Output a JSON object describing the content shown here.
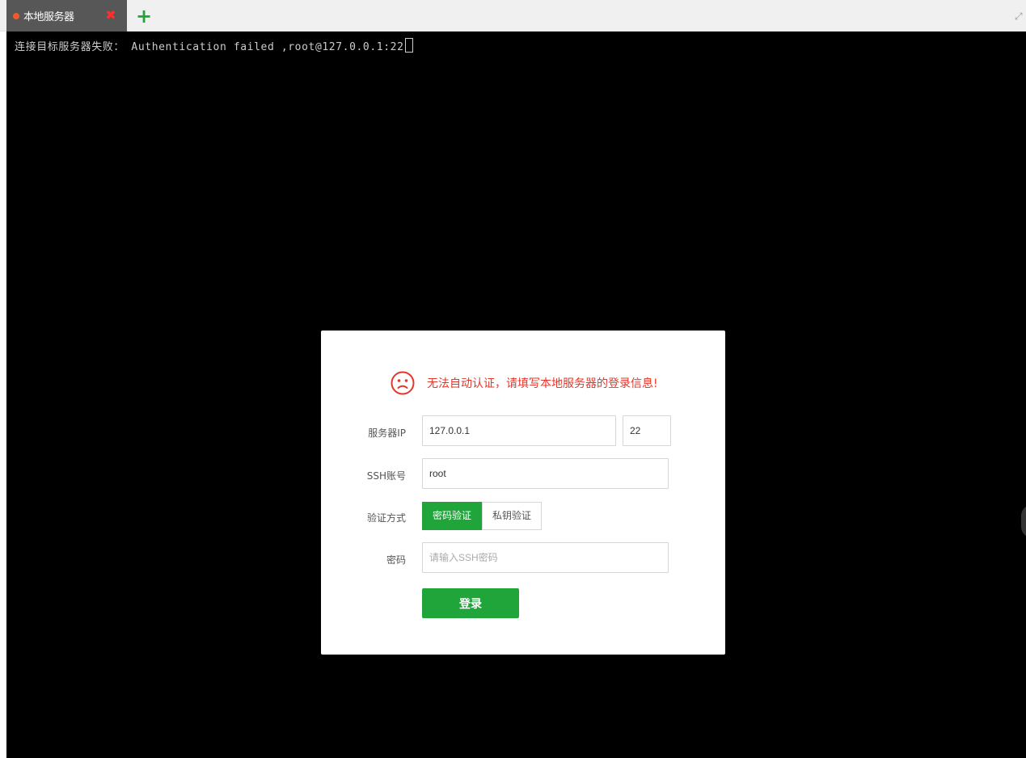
{
  "tabs": [
    {
      "label": "本地服务器",
      "status_color": "#f15a28",
      "close_icon": "close-icon"
    }
  ],
  "add_tab_icon": "plus-icon",
  "terminal": {
    "line": "连接目标服务器失败： Authentication failed ,root@127.0.0.1:22"
  },
  "dialog": {
    "error_icon": "sad-face-icon",
    "error_text": "无法自动认证，请填写本地服务器的登录信息!",
    "server_ip_label": "服务器IP",
    "server_ip_value": "127.0.0.1",
    "port_value": "22",
    "ssh_account_label": "SSH账号",
    "ssh_account_value": "root",
    "auth_method_label": "验证方式",
    "auth_methods": [
      "密码验证",
      "私钥验证"
    ],
    "auth_selected": "密码验证",
    "password_label": "密码",
    "password_placeholder": "请输入SSH密码",
    "login_label": "登录"
  },
  "colors": {
    "accent": "#20a53a",
    "error": "#e5362a",
    "terminal_bg": "#000000"
  }
}
